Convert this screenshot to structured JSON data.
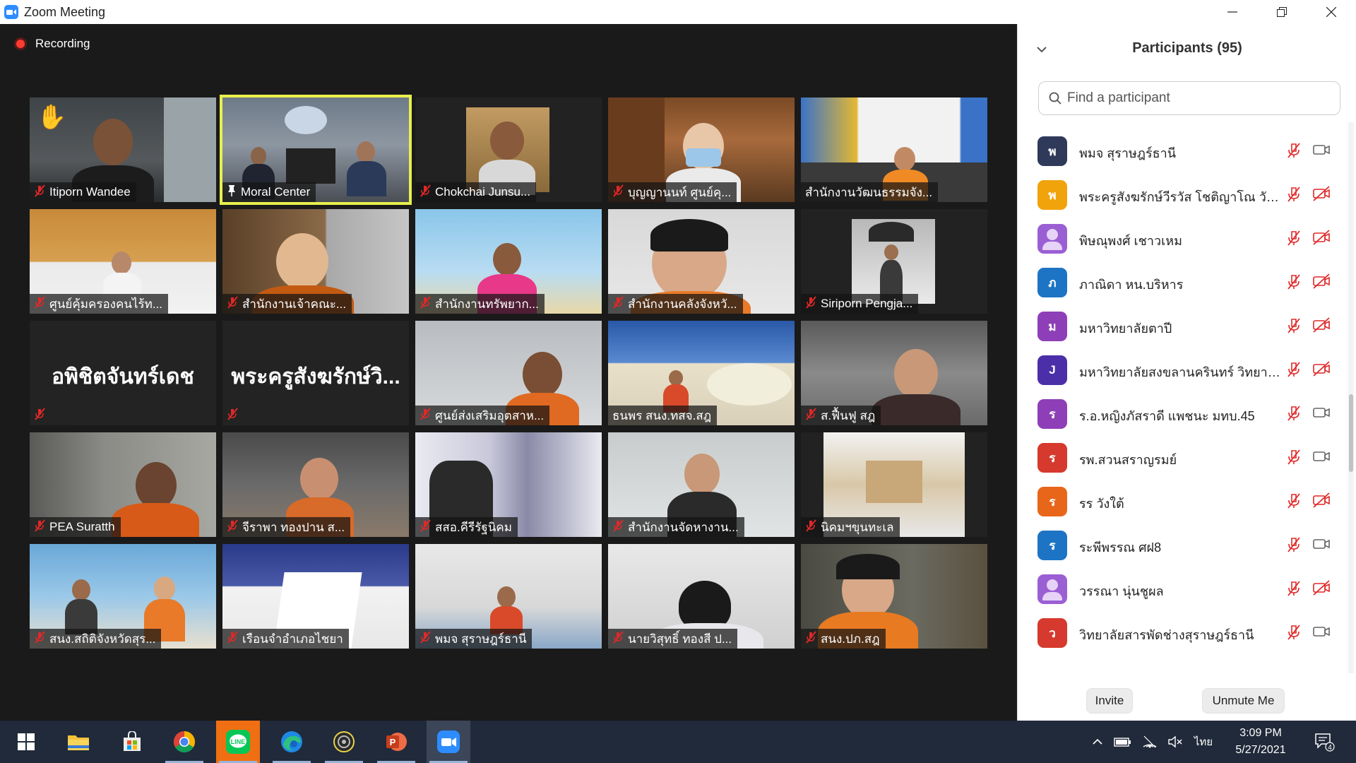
{
  "window": {
    "title": "Zoom Meeting"
  },
  "meeting": {
    "recording_label": "Recording"
  },
  "tiles": [
    {
      "name": "Itiporn Wandee",
      "muted": true,
      "hand_raised": true
    },
    {
      "name": "Moral Center",
      "pinned": true,
      "speaking": true
    },
    {
      "name": "Chokchai Junsu...",
      "muted": true
    },
    {
      "name": "บุญญานนท์ ศูนย์คุ...",
      "muted": true
    },
    {
      "name": "สำนักงานวัฒนธรรมจัง...",
      "muted": false
    },
    {
      "name": "ศูนย์คุ้มครองคนไร้ท...",
      "muted": true
    },
    {
      "name": "สำนักงานเจ้าคณะ...",
      "muted": true
    },
    {
      "name": "สำนักงานทรัพยาก...",
      "muted": true
    },
    {
      "name": "สำนักงานคลังจังหวั...",
      "muted": true
    },
    {
      "name": "Siriporn Pengja...",
      "muted": true
    },
    {
      "name": "",
      "display_name": "อพิชิตจันทร์เดช",
      "muted": true,
      "video_off": true
    },
    {
      "name": "",
      "display_name": "พระครูสังฆรักษ์วิ...",
      "muted": true,
      "video_off": true
    },
    {
      "name": "ศูนย์ส่งเสริมอุตสาห...",
      "muted": true
    },
    {
      "name": "ธนพร สนง.ทสจ.สฎ",
      "muted": false
    },
    {
      "name": "ส.ฟื้นฟู สฎ",
      "muted": true
    },
    {
      "name": "PEA Suratth",
      "muted": true
    },
    {
      "name": "จีราพา ทองปาน ส...",
      "muted": true
    },
    {
      "name": "สสอ.คีรีรัฐนิคม",
      "muted": true
    },
    {
      "name": "สำนักงานจัดหางาน...",
      "muted": true
    },
    {
      "name": "นิคมฯขุนทะเล",
      "muted": true
    },
    {
      "name": "สนง.สถิติจังหวัดสุร...",
      "muted": true
    },
    {
      "name": "เรือนจำอำเภอไชยา",
      "muted": true
    },
    {
      "name": "พมจ สุราษฎร์ธานี",
      "muted": true
    },
    {
      "name": "นายวิสุทธิ์  ทองสี ป...",
      "muted": true
    },
    {
      "name": "สนง.ปภ.สฎ",
      "muted": true
    }
  ],
  "participants_panel": {
    "title": "Participants (95)",
    "search_placeholder": "Find a participant",
    "invite_label": "Invite",
    "unmute_label": "Unmute Me",
    "participants": [
      {
        "initial": "พ",
        "color": "#2f3a5a",
        "name": "พมจ สุราษฎร์ธานี",
        "mic": "muted",
        "camera": "on"
      },
      {
        "initial": "พ",
        "color": "#f0a30a",
        "name": "พระครูสังฆรักษ์วีรวัส โชติญาโณ วัด...",
        "mic": "muted",
        "camera": "off"
      },
      {
        "initial": "",
        "color": "#9b5fd4",
        "name": "พิษณุพงศ์ เชาวเหม",
        "mic": "muted",
        "camera": "off",
        "generic_avatar": true
      },
      {
        "initial": "ภ",
        "color": "#1e74c4",
        "name": "ภาณิดา หน.บริหาร",
        "mic": "muted",
        "camera": "off"
      },
      {
        "initial": "ม",
        "color": "#8e3fb8",
        "name": "มหาวิทยาลัยตาปี",
        "mic": "muted",
        "camera": "off"
      },
      {
        "initial": "J",
        "color": "#4b2fa8",
        "name": "มหาวิทยาลัยสงขลานครินทร์ วิทยาเข...",
        "mic": "muted",
        "camera": "off"
      },
      {
        "initial": "ร",
        "color": "#8e3fb8",
        "name": "ร.อ.หญิงภัสราดี แพชนะ มทบ.45",
        "mic": "muted",
        "camera": "on"
      },
      {
        "initial": "ร",
        "color": "#d6392e",
        "name": "รพ.สวนสราญรมย์",
        "mic": "muted",
        "camera": "on"
      },
      {
        "initial": "ร",
        "color": "#e8661a",
        "name": "รร วังใต้",
        "mic": "muted",
        "camera": "off"
      },
      {
        "initial": "ร",
        "color": "#1e74c4",
        "name": "ระพีพรรณ ศฝ8",
        "mic": "muted",
        "camera": "on"
      },
      {
        "initial": "",
        "color": "#9b5fd4",
        "name": "วรรณา นุ่นชูผล",
        "mic": "muted",
        "camera": "off",
        "generic_avatar": true
      },
      {
        "initial": "ว",
        "color": "#d6392e",
        "name": "วิทยาลัยสารพัดช่างสุราษฎร์ธานี",
        "mic": "muted",
        "camera": "on"
      }
    ]
  },
  "taskbar": {
    "apps": [
      "start-icon",
      "file-explorer-icon",
      "store-icon",
      "chrome-icon",
      "line-icon",
      "edge-icon",
      "camera-app-icon",
      "powerpoint-icon",
      "zoom-icon"
    ],
    "language": "ไทย",
    "time": "3:09 PM",
    "date": "5/27/2021",
    "notification_count": "4"
  },
  "colors": {
    "accent": "#2d8cff",
    "muted_red": "#e02828",
    "active_speaker": "#e7f04b"
  }
}
